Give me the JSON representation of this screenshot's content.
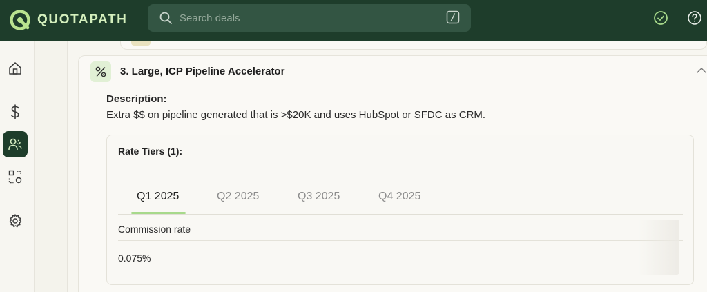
{
  "app": {
    "brand": "QUOTAPATH"
  },
  "search": {
    "placeholder": "Search deals"
  },
  "nav": {
    "items": [
      {
        "id": "home",
        "icon": "home-icon"
      },
      {
        "id": "commissions",
        "icon": "dollar-icon"
      },
      {
        "id": "team",
        "icon": "users-icon",
        "active": true
      },
      {
        "id": "assignments",
        "icon": "shapes-icon"
      },
      {
        "id": "settings",
        "icon": "gear-icon"
      }
    ]
  },
  "card": {
    "title": "3. Large, ICP Pipeline Accelerator",
    "description_label": "Description:",
    "description": "Extra $$ on pipeline generated that is >$20K and uses HubSpot or SFDC as CRM.",
    "rate_tiers_label": "Rate Tiers (1):",
    "tabs": [
      {
        "label": "Q1 2025",
        "active": true
      },
      {
        "label": "Q2 2025"
      },
      {
        "label": "Q3 2025"
      },
      {
        "label": "Q4 2025"
      }
    ],
    "table": {
      "header": "Commission rate",
      "value": "0.075%"
    }
  },
  "colors": {
    "brand_dark": "#1e3d2b",
    "accent": "#a7d98b"
  }
}
